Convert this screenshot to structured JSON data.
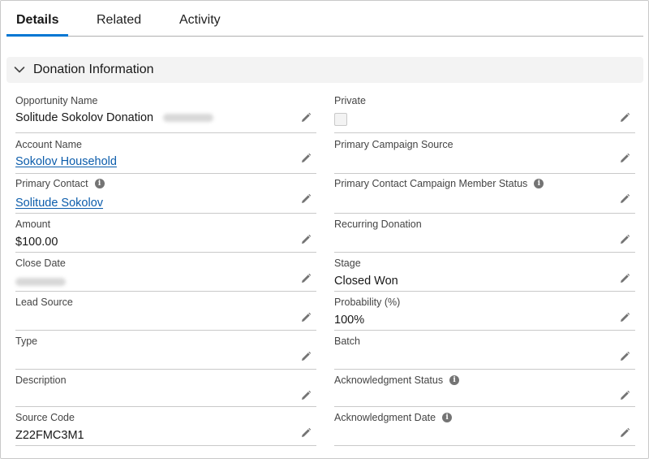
{
  "tabs": [
    {
      "label": "Details",
      "active": true
    },
    {
      "label": "Related",
      "active": false
    },
    {
      "label": "Activity",
      "active": false
    }
  ],
  "section": {
    "title": "Donation Information",
    "icon": "chevron-down-icon"
  },
  "fields": {
    "opportunity_name": {
      "label": "Opportunity Name",
      "value": "Solitude Sokolov Donation"
    },
    "private": {
      "label": "Private",
      "checked": false
    },
    "account_name": {
      "label": "Account Name",
      "value": "Sokolov Household"
    },
    "primary_campaign_source": {
      "label": "Primary Campaign Source",
      "value": ""
    },
    "primary_contact": {
      "label": "Primary Contact",
      "value": "Solitude Sokolov"
    },
    "primary_contact_campaign_member_status": {
      "label": "Primary Contact Campaign Member Status",
      "value": ""
    },
    "amount": {
      "label": "Amount",
      "value": "$100.00"
    },
    "recurring_donation": {
      "label": "Recurring Donation",
      "value": ""
    },
    "close_date": {
      "label": "Close Date",
      "value": ""
    },
    "stage": {
      "label": "Stage",
      "value": "Closed Won"
    },
    "lead_source": {
      "label": "Lead Source",
      "value": ""
    },
    "probability": {
      "label": "Probability (%)",
      "value": "100%"
    },
    "type": {
      "label": "Type",
      "value": ""
    },
    "batch": {
      "label": "Batch",
      "value": ""
    },
    "description": {
      "label": "Description",
      "value": ""
    },
    "acknowledgment_status": {
      "label": "Acknowledgment Status",
      "value": ""
    },
    "source_code": {
      "label": "Source Code",
      "value": "Z22FMC3M1"
    },
    "acknowledgment_date": {
      "label": "Acknowledgment Date",
      "value": ""
    }
  },
  "colors": {
    "accent": "#0176d3",
    "link": "#0b5cab",
    "section_bg": "#f3f3f3"
  }
}
